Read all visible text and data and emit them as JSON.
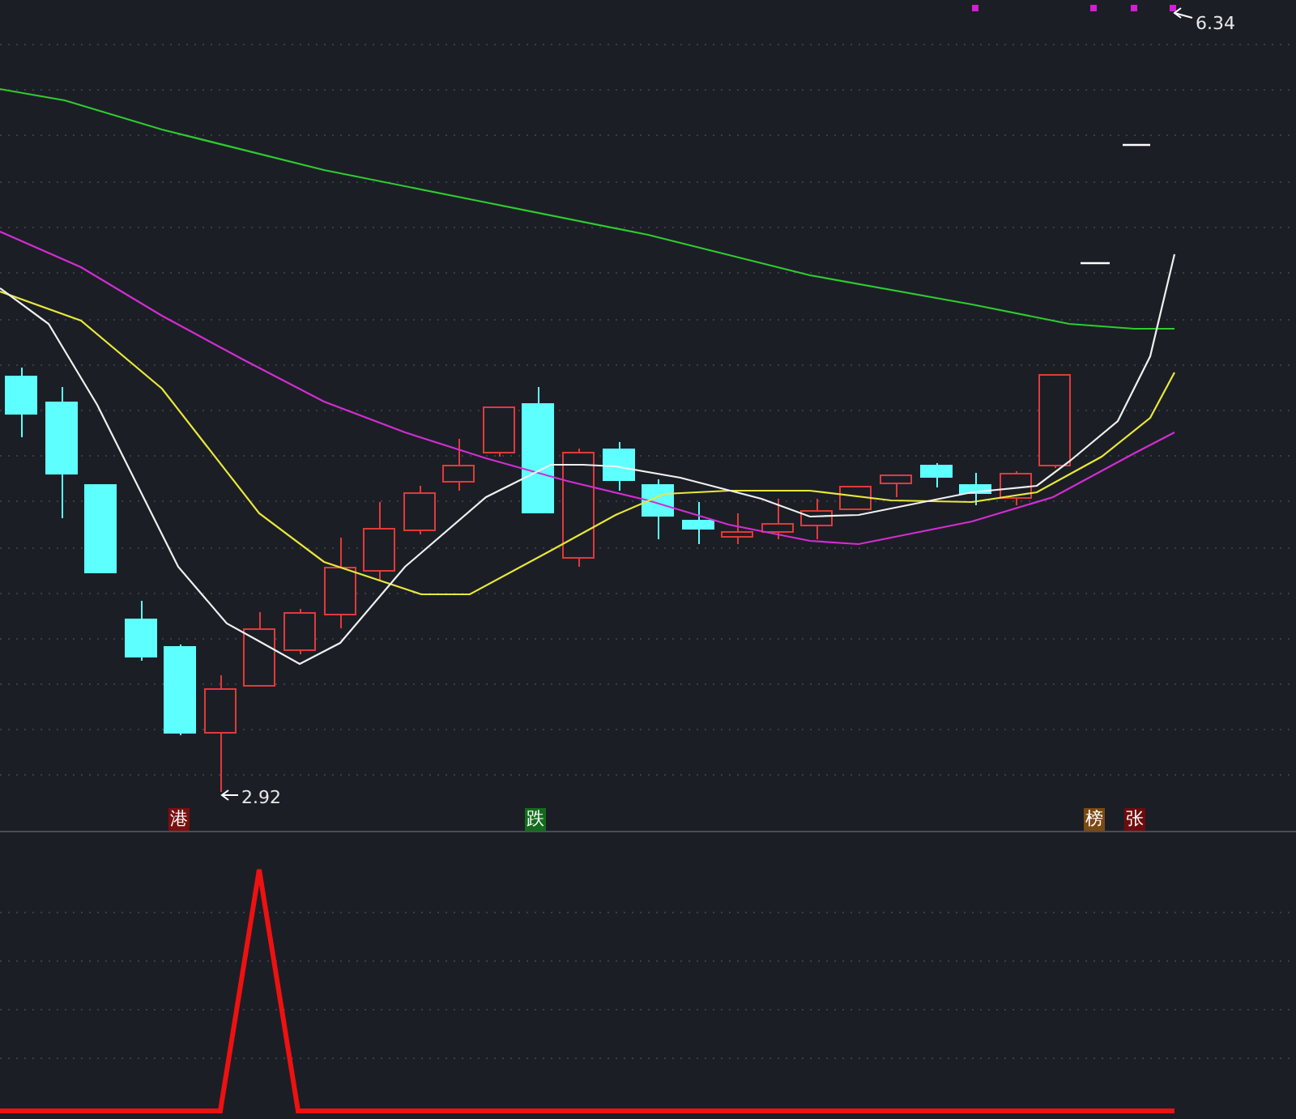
{
  "main_chart": {
    "price_labels": [
      {
        "kind": "high",
        "text": "6.34"
      },
      {
        "kind": "low",
        "text": "2.92"
      }
    ],
    "event_badges": [
      {
        "text": "港",
        "color": "#7a1010"
      },
      {
        "text": "跌",
        "color": "#136b1c"
      },
      {
        "text": "榜",
        "color": "#7a4a12"
      },
      {
        "text": "张",
        "color": "#6e0c0c"
      }
    ]
  }
}
